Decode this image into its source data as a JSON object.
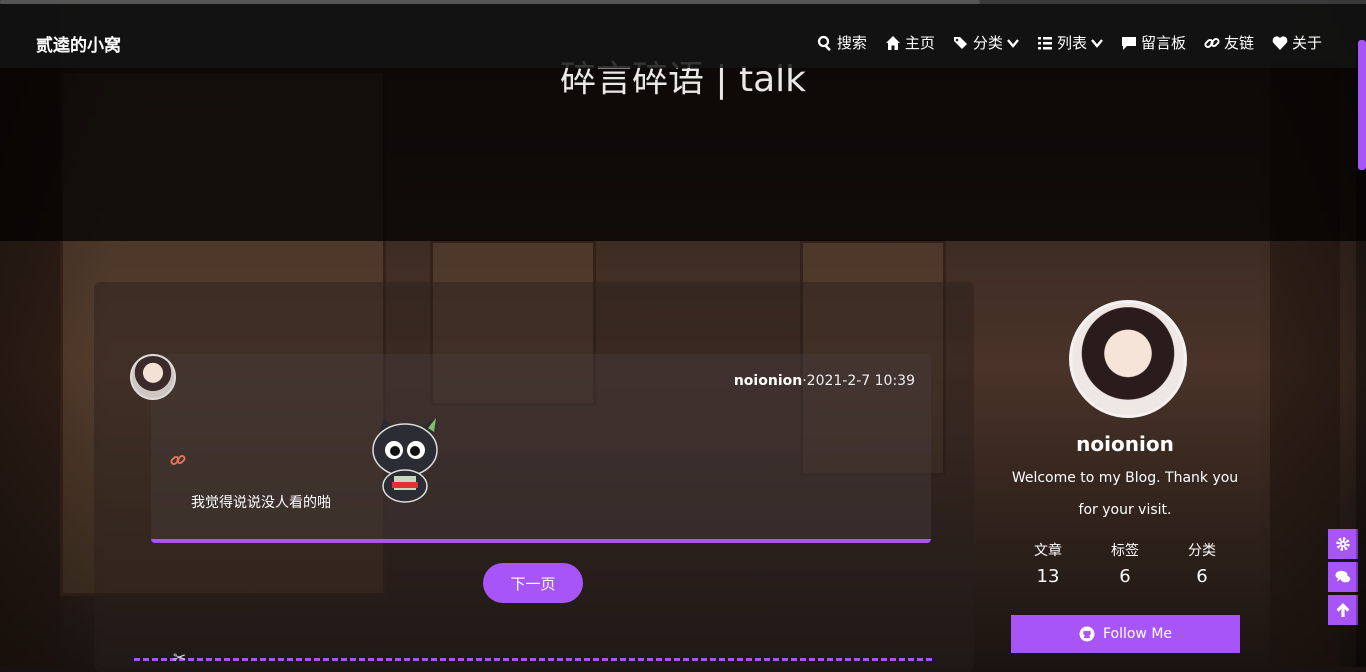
{
  "brand": "贰逵的小窝",
  "nav": {
    "search": "搜索",
    "home": "主页",
    "categories": "分类",
    "list": "列表",
    "guestbook": "留言板",
    "friends": "友链",
    "about": "关于"
  },
  "page_title": "碎言碎语 | talk",
  "post": {
    "author": "noionion",
    "separator": "·",
    "datetime": "2021-2-7 10:39",
    "text": "我觉得说说没人看的啪"
  },
  "pagination": {
    "next_label": "下一页"
  },
  "profile": {
    "name": "noionion",
    "description": "Welcome to my Blog. Thank you for your visit.",
    "stats": [
      {
        "label": "文章",
        "value": "13"
      },
      {
        "label": "标签",
        "value": "6"
      },
      {
        "label": "分类",
        "value": "6"
      }
    ],
    "follow_label": "Follow Me"
  },
  "colors": {
    "accent": "#a855f7"
  }
}
